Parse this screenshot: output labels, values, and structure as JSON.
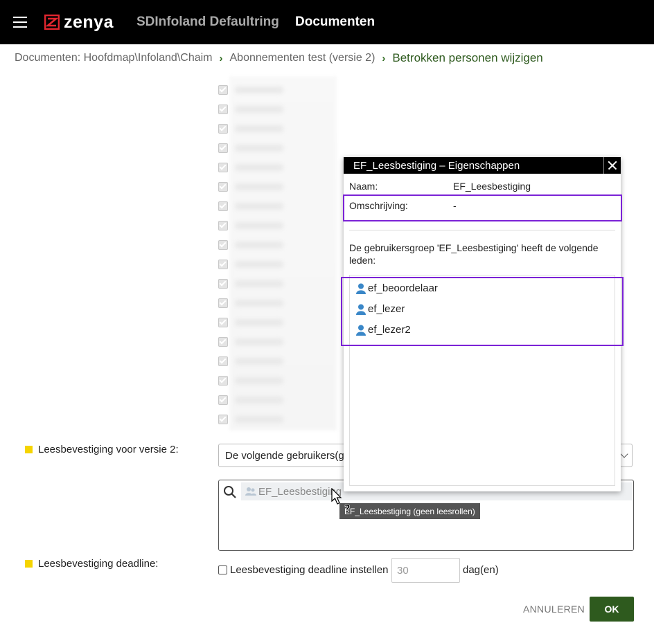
{
  "header": {
    "logo_text": "zenya",
    "tenant": "SDInfoland Defaultring",
    "section": "Documenten"
  },
  "breadcrumb": {
    "items": [
      "Documenten: Hoofdmap\\Infoland\\Chaim",
      "Abonnementen test (versie 2)"
    ],
    "current": "Betrokken personen wijzigen"
  },
  "form": {
    "read_confirm_label": "Leesbevestiging voor versie 2:",
    "select_value": "De volgende gebruikers(gr",
    "picker_chip": "EF_Leesbestiging",
    "tooltip": "EF_Leesbestiging (geen leesrollen)",
    "deadline_label": "Leesbevestiging deadline:",
    "deadline_checkbox_label": "Leesbevestiging deadline instellen",
    "deadline_days_placeholder": "30",
    "deadline_unit": "dag(en)",
    "cancel_label": "ANNULEREN",
    "ok_label": "OK"
  },
  "dialog": {
    "title": "EF_Leesbestiging – Eigenschappen",
    "name_label": "Naam:",
    "name_value": "EF_Leesbestiging",
    "description_label": "Omschrijving:",
    "description_value": "-",
    "members_intro": "De gebruikersgroep 'EF_Leesbestiging' heeft de volgende leden:",
    "members": [
      "ef_beoordelaar",
      "ef_lezer",
      "ef_lezer2"
    ]
  },
  "colors": {
    "topbar": "#000000",
    "brand_red": "#e3262f",
    "accent_green": "#2e5a1e",
    "highlight_purple": "#7b22d6",
    "required_yellow": "#f5d400",
    "user_icon_blue": "#3a87c8"
  }
}
